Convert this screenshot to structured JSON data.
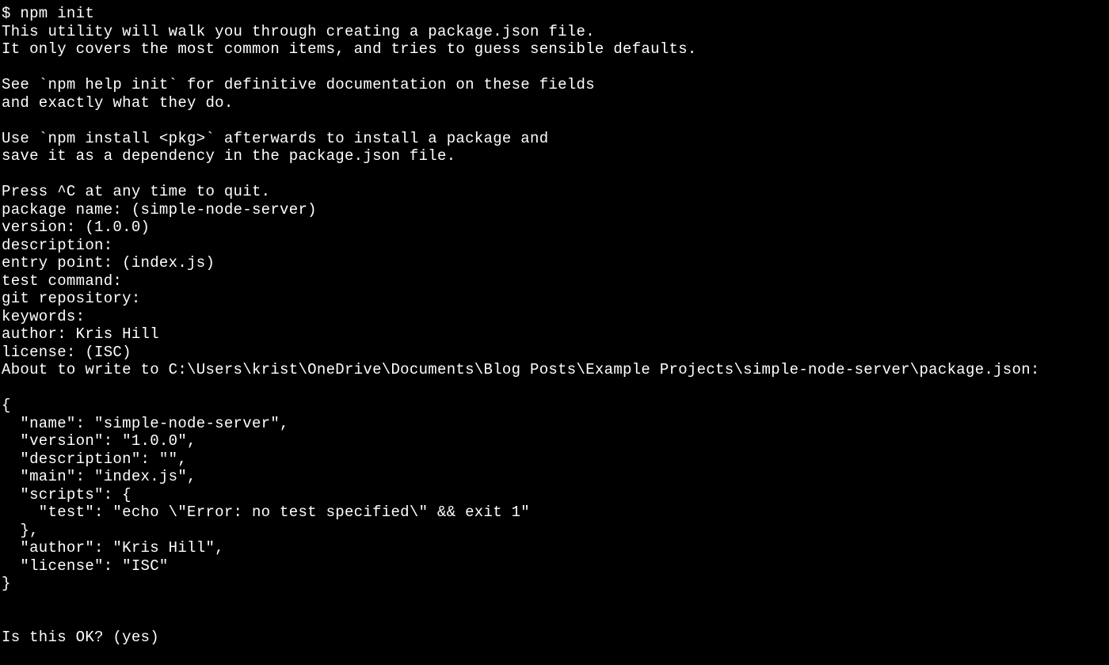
{
  "terminal": {
    "top_fragment": "",
    "prompt_symbol": "$ ",
    "command": "npm init",
    "intro": [
      "This utility will walk you through creating a package.json file.",
      "It only covers the most common items, and tries to guess sensible defaults.",
      "",
      "See `npm help init` for definitive documentation on these fields",
      "and exactly what they do.",
      "",
      "Use `npm install <pkg>` afterwards to install a package and",
      "save it as a dependency in the package.json file.",
      "",
      "Press ^C at any time to quit."
    ],
    "prompts": [
      "package name: (simple-node-server)",
      "version: (1.0.0)",
      "description:",
      "entry point: (index.js)",
      "test command:",
      "git repository:",
      "keywords:",
      "author: Kris Hill",
      "license: (ISC)"
    ],
    "about_to_write": "About to write to C:\\Users\\krist\\OneDrive\\Documents\\Blog Posts\\Example Projects\\simple-node-server\\package.json:",
    "json_output": [
      "",
      "{",
      "  \"name\": \"simple-node-server\",",
      "  \"version\": \"1.0.0\",",
      "  \"description\": \"\",",
      "  \"main\": \"index.js\",",
      "  \"scripts\": {",
      "    \"test\": \"echo \\\"Error: no test specified\\\" && exit 1\"",
      "  },",
      "  \"author\": \"Kris Hill\",",
      "  \"license\": \"ISC\"",
      "}",
      "",
      ""
    ],
    "confirm": "Is this OK? (yes)"
  }
}
